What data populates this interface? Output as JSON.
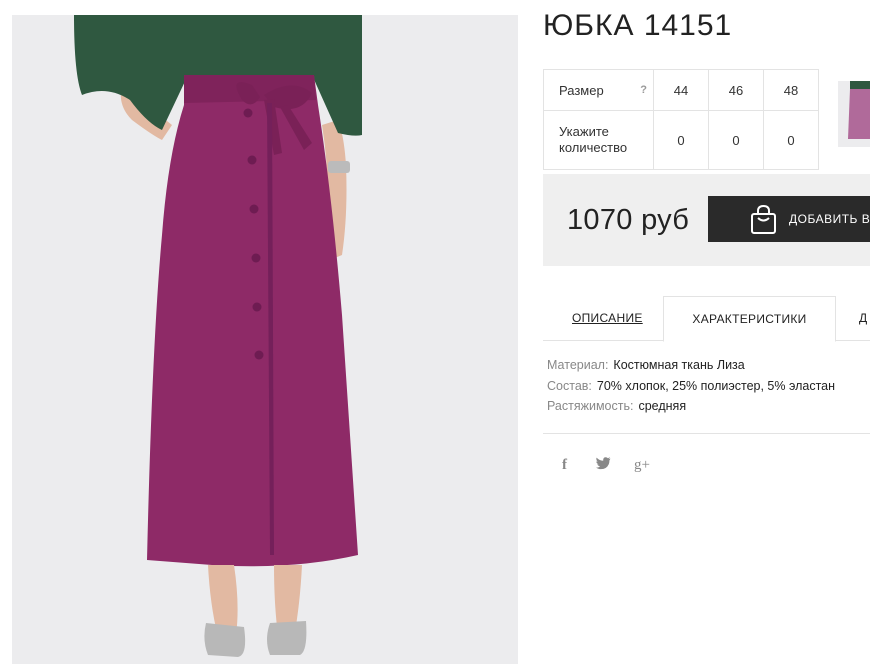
{
  "product": {
    "title": "ЮБКА 14151",
    "image_alt": "Юбка 14151"
  },
  "size_table": {
    "size_label": "Размер",
    "help_mark": "?",
    "sizes": [
      "44",
      "46",
      "48"
    ],
    "quantity_label": "Укажите количество",
    "quantities": [
      "0",
      "0",
      "0"
    ]
  },
  "purchase": {
    "price": "1070 руб",
    "add_button_label": "ДОБАВИТЬ В"
  },
  "tabs": [
    {
      "label": "ОПИСАНИЕ"
    },
    {
      "label": "ХАРАКТЕРИСТИКИ"
    },
    {
      "label": "Д"
    }
  ],
  "characteristics": [
    {
      "key": "Материал:",
      "value": "Костюмная ткань Лиза"
    },
    {
      "key": "Состав:",
      "value": "70% хлопок, 25% полиэстер, 5% эластан"
    },
    {
      "key": "Растяжимость:",
      "value": "средняя"
    }
  ],
  "social": {
    "facebook": "f",
    "twitter": "t",
    "googleplus": "g+"
  },
  "colors": {
    "skirt": "#8e2a67",
    "sweater": "#2f5840",
    "button_bg": "#2a2a2a",
    "price_bg": "#efefef"
  },
  "icons": [
    "bag-icon",
    "facebook-icon",
    "twitter-icon",
    "google-plus-icon"
  ]
}
